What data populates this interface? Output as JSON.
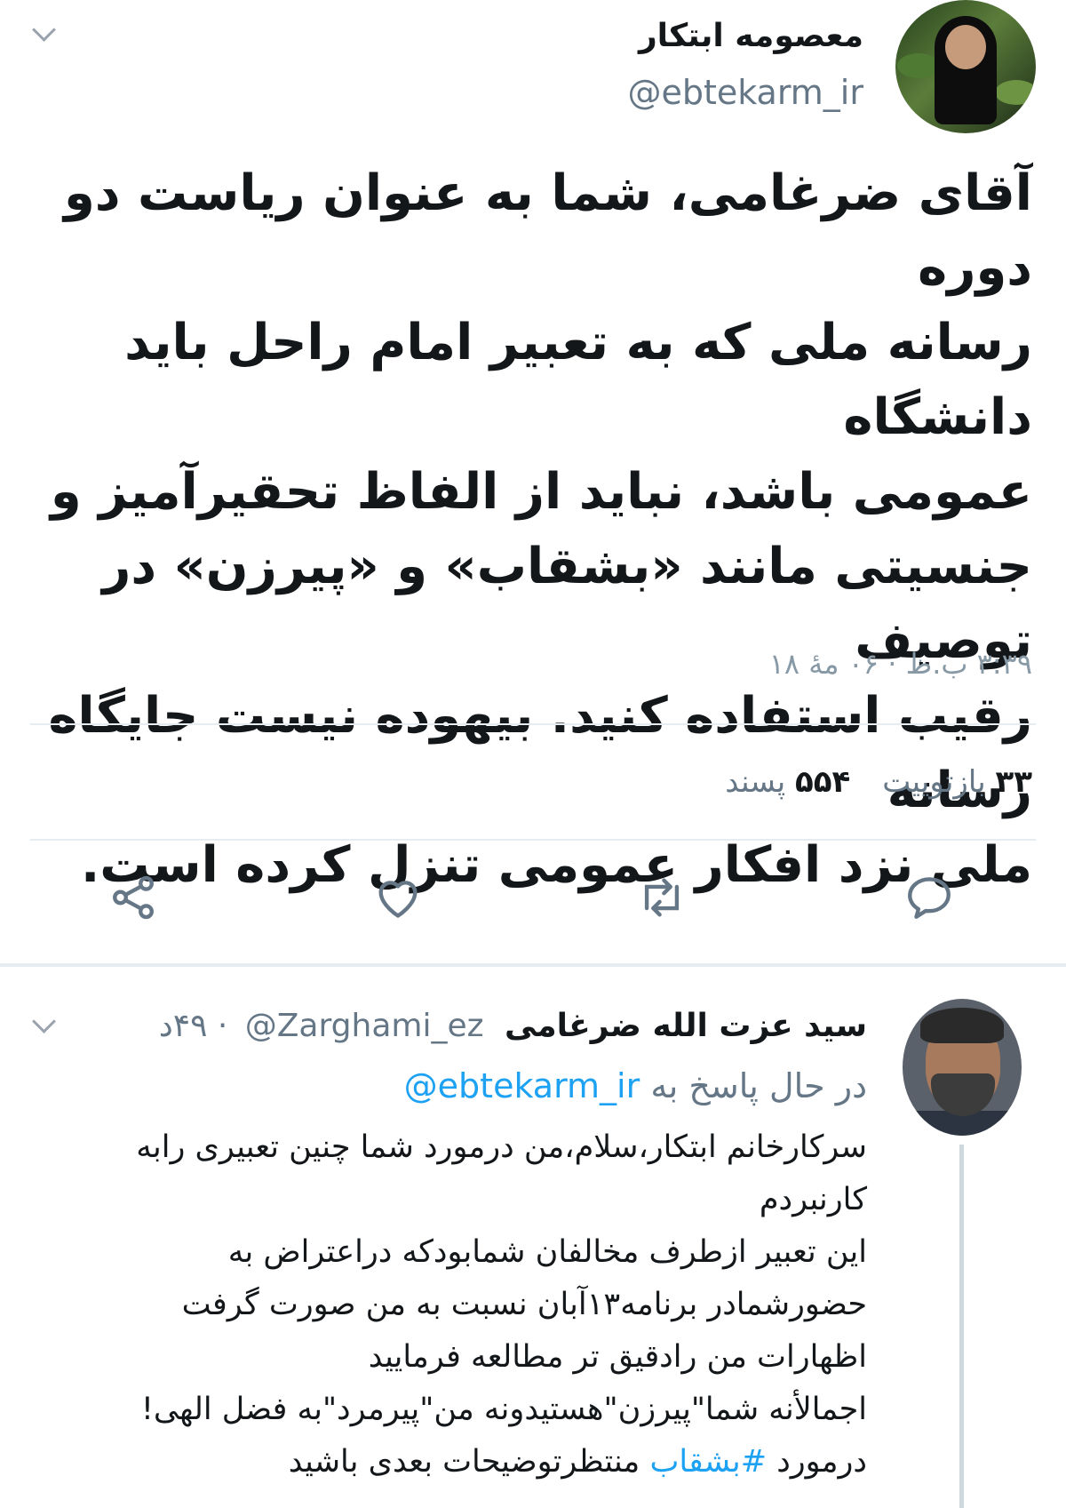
{
  "tweet": {
    "author_name": "معصومه ابتکار",
    "author_handle": "@ebtekarm_ir",
    "text": "آقای ضرغامی، شما به عنوان ریاست دو دوره\nرسانه ملی که به تعبیر امام راحل باید دانشگاه\nعمومی باشد، نباید از الفاظ تحقیرآمیز و\nجنسیتی مانند «بشقاب» و «پیرزن» در توصیف\nرقیب استفاده کنید. بیهوده نیست جایگاه رسانه\nملی نزد افکار عمومی تنزل کرده است.",
    "timestamp": "۳:۳۹ ب.ظ · ۰۶ مهٔ ۱۸",
    "retweets_count": "۳۳",
    "retweets_label": "بازتوییت",
    "likes_count": "۵۵۴",
    "likes_label": "پسند"
  },
  "actions": [
    {
      "name": "reply-icon"
    },
    {
      "name": "retweet-icon"
    },
    {
      "name": "like-icon"
    },
    {
      "name": "share-icon"
    }
  ],
  "reply": {
    "author_name": "سید عزت الله ضرغامی",
    "author_handle": "@Zarghami_ez",
    "time": "· ۴۹د",
    "replying_prefix": "در حال پاسخ به",
    "replying_to": "@ebtekarm_ir",
    "lines": [
      "سرکارخانم ابتکار،سلام،من درمورد شما چنین تعبیری رابه",
      "کارنبردم",
      "این تعبیر ازطرف مخالفان شمابودکه دراعتراض به",
      "حضورشمادر برنامه۱۳آبان نسبت به من صورت گرفت",
      "اظهارات من رادقیق تر مطالعه فرمایید",
      "اجمالأنه شما\"پیرزن\"هستیدونه من\"پیرمرد\"به فضل الهی!"
    ],
    "last_line_prefix": "درمورد",
    "hashtag": "#بشقاب",
    "last_line_suffix": "منتظرتوضیحات بعدی باشید"
  },
  "colors": {
    "link": "#1da1f2",
    "secondary_text": "#657786",
    "icon": "#657786"
  }
}
